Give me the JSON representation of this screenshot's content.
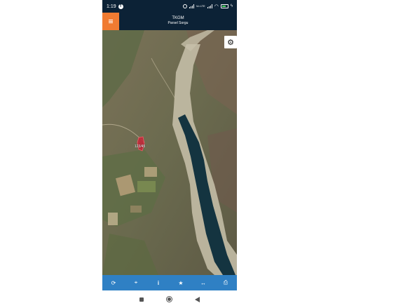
{
  "status_bar": {
    "time": "1:19",
    "facebook_icon": "facebook-icon",
    "network_label": "Vo LTE",
    "battery_level": 0.8
  },
  "app_bar": {
    "title": "TKGM",
    "subtitle": "Parsel Sorgu",
    "menu_icon": "hamburger-menu-icon",
    "accent_color": "#f07b32",
    "background_color": "#0c2236"
  },
  "map": {
    "parcel_label": "123/45",
    "settings_icon": "gear-icon"
  },
  "toolbar": {
    "background_color": "#2f80c4",
    "items": [
      {
        "icon": "refresh-icon",
        "glyph": "⟳"
      },
      {
        "icon": "locate-icon",
        "glyph": "⌖"
      },
      {
        "icon": "info-icon",
        "glyph": "i"
      },
      {
        "icon": "star-icon",
        "glyph": "★"
      },
      {
        "icon": "measure-icon",
        "glyph": "↔"
      },
      {
        "icon": "print-icon",
        "glyph": "⎙"
      }
    ]
  },
  "nav_bar": {
    "icons": [
      "recent-apps-icon",
      "home-icon",
      "back-icon"
    ]
  }
}
